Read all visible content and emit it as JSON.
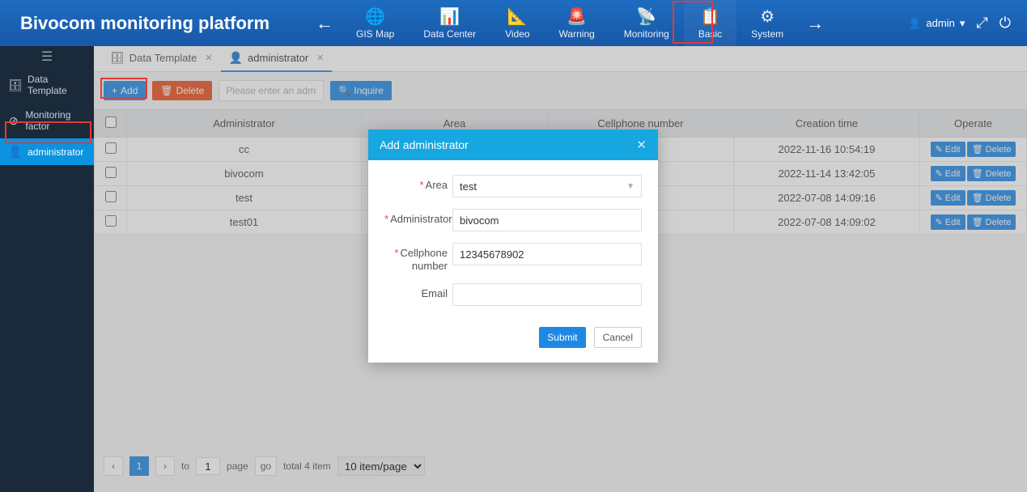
{
  "header": {
    "title": "Bivocom monitoring platform",
    "nav": [
      {
        "label": "GIS Map",
        "icon": "🌐"
      },
      {
        "label": "Data Center",
        "icon": "📊"
      },
      {
        "label": "Video",
        "icon": "📐"
      },
      {
        "label": "Warning",
        "icon": "🚨"
      },
      {
        "label": "Monitoring",
        "icon": "📡"
      },
      {
        "label": "Basic",
        "icon": "📋"
      },
      {
        "label": "System",
        "icon": "⚙"
      }
    ],
    "user": "admin"
  },
  "sidebar": {
    "items": [
      {
        "label": "Data Template",
        "icon": "🗄"
      },
      {
        "label": "Monitoring factor",
        "icon": "⊘"
      },
      {
        "label": "administrator",
        "icon": "👤"
      }
    ]
  },
  "tabs": [
    {
      "label": "Data Template",
      "icon": "🗄"
    },
    {
      "label": "administrator",
      "icon": "👤"
    }
  ],
  "toolbar": {
    "add": "Add",
    "delete": "Delete",
    "inquire": "Inquire",
    "search_placeholder": "Please enter an adminis"
  },
  "table": {
    "headers": [
      "",
      "Administrator",
      "Area",
      "Cellphone number",
      "Creation time",
      "Operate"
    ],
    "rows": [
      {
        "admin": "cc",
        "area": "",
        "phone": "",
        "time": "2022-11-16 10:54:19"
      },
      {
        "admin": "bivocom",
        "area": "",
        "phone": "",
        "time": "2022-11-14 13:42:05"
      },
      {
        "admin": "test",
        "area": "",
        "phone": "",
        "time": "2022-07-08 14:09:16"
      },
      {
        "admin": "test01",
        "area": "",
        "phone": "",
        "time": "2022-07-08 14:09:02"
      }
    ],
    "edit_label": "Edit",
    "delete_label": "Delete"
  },
  "pager": {
    "current": "1",
    "to_label": "to",
    "to_value": "1",
    "page_label": "page",
    "go_label": "go",
    "total_label": "total 4 item",
    "size_label": "10 item/page"
  },
  "dialog": {
    "title": "Add administrator",
    "fields": {
      "area_label": "Area",
      "area_value": "test",
      "admin_label": "Administrator",
      "admin_value": "bivocom",
      "phone_label": "Cellphone number",
      "phone_value": "12345678902",
      "email_label": "Email",
      "email_value": ""
    },
    "submit": "Submit",
    "cancel": "Cancel"
  }
}
